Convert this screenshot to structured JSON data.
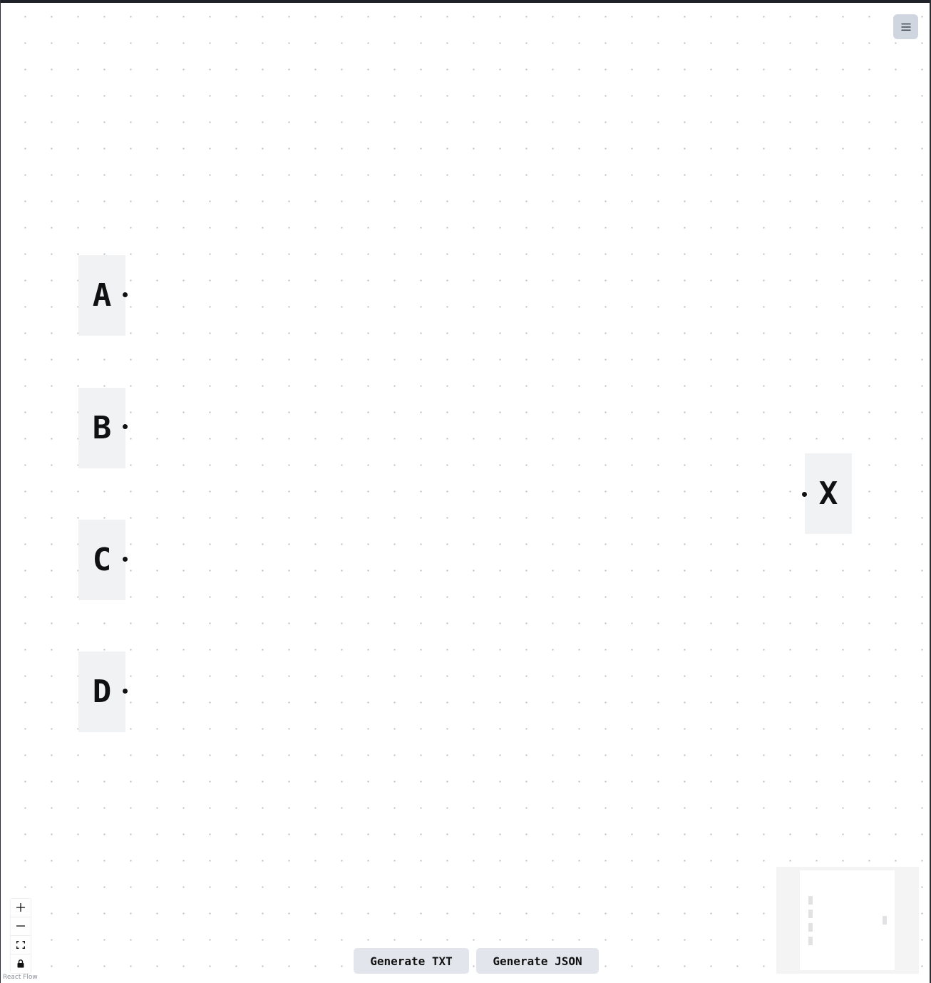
{
  "menu_button": {
    "icon": "hamburger-menu-icon"
  },
  "nodes": {
    "a": {
      "label": "A"
    },
    "b": {
      "label": "B"
    },
    "c": {
      "label": "C"
    },
    "d": {
      "label": "D"
    },
    "x": {
      "label": "X"
    }
  },
  "controls": {
    "zoom_in": {
      "icon": "plus-icon"
    },
    "zoom_out": {
      "icon": "minus-icon"
    },
    "fit_view": {
      "icon": "fit-view-icon"
    },
    "lock": {
      "icon": "lock-icon"
    }
  },
  "attribution": "React Flow",
  "actions": {
    "generate_txt": "Generate TXT",
    "generate_json": "Generate JSON"
  },
  "colors": {
    "node_background": "#f1f2f4",
    "menu_button_background": "#cfd6e0",
    "action_button_background": "#e2e6ec",
    "handle": "#111111",
    "grid_dot": "#b9bcc2"
  }
}
